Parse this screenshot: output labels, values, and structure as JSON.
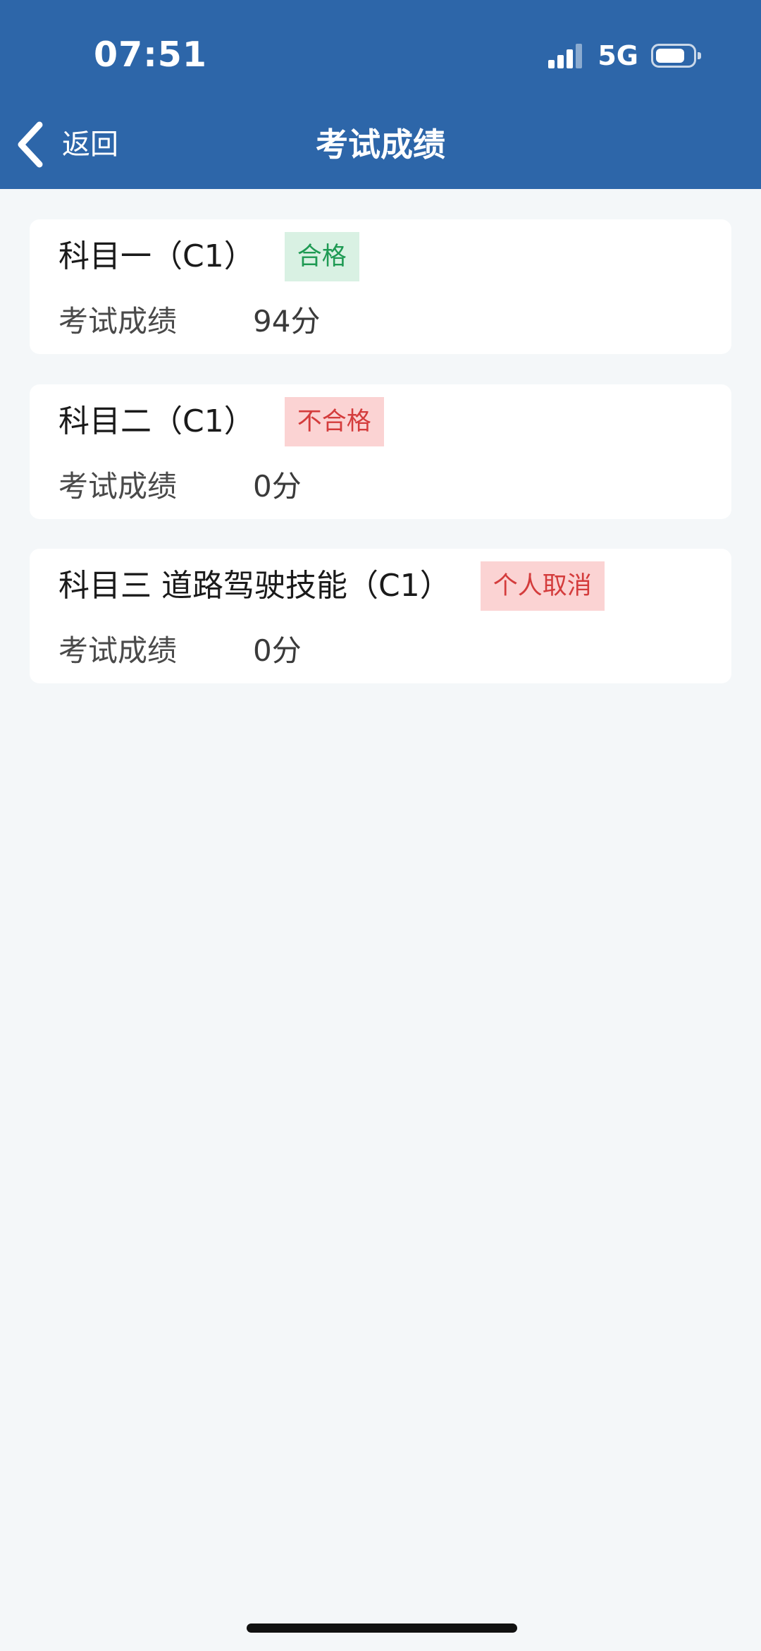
{
  "status_bar": {
    "time": "07:51",
    "network": "5G",
    "icons": [
      "signal-icon",
      "battery-icon"
    ]
  },
  "header": {
    "back_label": "返回",
    "title": "考试成绩",
    "background_color": "#2d66a9"
  },
  "results": [
    {
      "subject": "科目一（C1）",
      "status": "合格",
      "status_type": "pass",
      "score_label": "考试成绩",
      "score": "94分"
    },
    {
      "subject": "科目二（C1）",
      "status": "不合格",
      "status_type": "fail",
      "score_label": "考试成绩",
      "score": "0分"
    },
    {
      "subject": "科目三 道路驾驶技能（C1）",
      "status": "个人取消",
      "status_type": "fail",
      "score_label": "考试成绩",
      "score": "0分"
    }
  ],
  "colors": {
    "pass_text": "#1e9a53",
    "pass_background": "#d9f1e3",
    "fail_text": "#d43c3c",
    "fail_background": "#fbd3d3"
  }
}
